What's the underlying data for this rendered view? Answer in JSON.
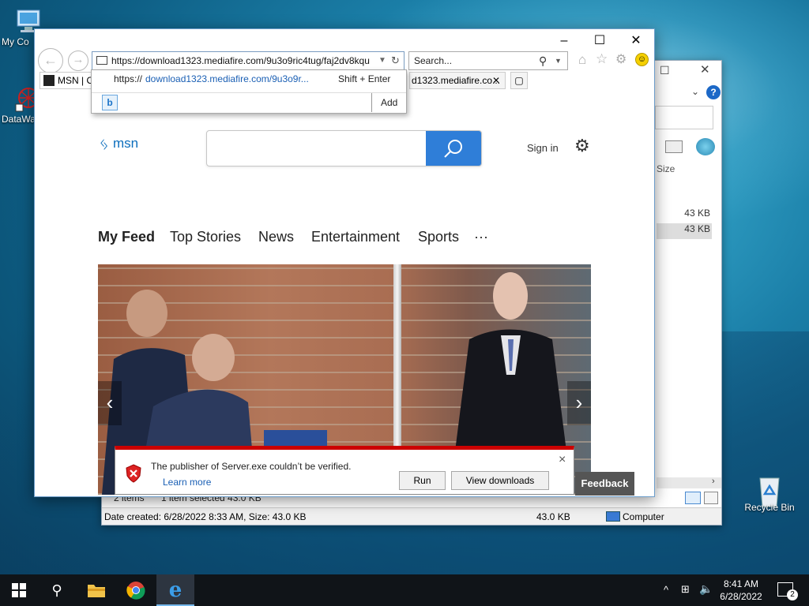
{
  "desktop": {
    "icons": [
      {
        "label": "My Computer",
        "label_display": "My Co"
      },
      {
        "label": "DataWa",
        "label_display": "DataWa"
      },
      {
        "label": "Recycle Bin",
        "label_display": "Recycle Bin"
      }
    ]
  },
  "explorer": {
    "column_size": "Size",
    "rows": [
      "43 KB",
      "43 KB"
    ],
    "items_count": "2 items",
    "selected_info": "1 item selected  43.0 KB",
    "status_left": "Date created: 6/28/2022 8:33 AM, Size: 43.0 KB",
    "status_size": "43.0 KB",
    "status_location": "Computer"
  },
  "browser": {
    "address_url": "https://download1323.mediafire.com/9u3o9ric4tug/faj2dv8kqu",
    "search_placeholder": "Search...",
    "tabs": [
      {
        "label": "MSN | O"
      },
      {
        "label": "d1323.mediafire.co..."
      }
    ],
    "autocomplete": {
      "suggestion_prefix": "https://",
      "suggestion_highlight": "download1323.mediafire.com/9u3o9r...",
      "shortcut": "Shift + Enter",
      "add_label": "Add"
    },
    "window_controls": {
      "minimize": "–",
      "maximize": "☐",
      "close": "✕"
    }
  },
  "msn": {
    "logo_text": "msn",
    "sign_in": "Sign in",
    "feed_tabs": [
      "My Feed",
      "Top Stories",
      "News",
      "Entertainment",
      "Sports",
      "···"
    ],
    "feedback_label": "Feedback"
  },
  "notification": {
    "message": "The publisher of Server.exe couldn’t be verified.",
    "learn_more": "Learn more",
    "run_label": "Run",
    "view_downloads_label": "View downloads",
    "close": "×"
  },
  "taskbar": {
    "time": "8:41 AM",
    "date": "6/28/2022",
    "notification_count": "2"
  },
  "colors": {
    "accent": "#2f7ed8",
    "msn_blue": "#0c6ebd",
    "warning_red": "#cc0000",
    "taskbar": "#101418"
  }
}
